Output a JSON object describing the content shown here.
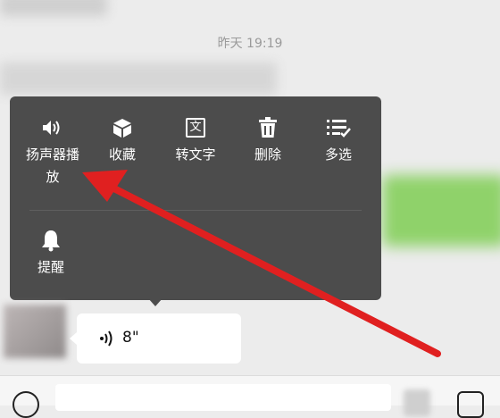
{
  "chat": {
    "timestamp": "昨天 19:19",
    "voice_duration": "8\""
  },
  "context_menu": {
    "items": [
      {
        "label": "扬声器播\n放",
        "icon": "speaker-icon"
      },
      {
        "label": "收藏",
        "icon": "cube-icon"
      },
      {
        "label": "转文字",
        "icon": "text-convert-icon"
      },
      {
        "label": "删除",
        "icon": "trash-icon"
      },
      {
        "label": "多选",
        "icon": "multi-select-icon"
      },
      {
        "label": "提醒",
        "icon": "bell-icon"
      }
    ],
    "text_icon_glyph": "文"
  },
  "colors": {
    "menu_bg": "#4c4c4c",
    "arrow": "#e02020",
    "green_bubble": "#8fd26a"
  }
}
